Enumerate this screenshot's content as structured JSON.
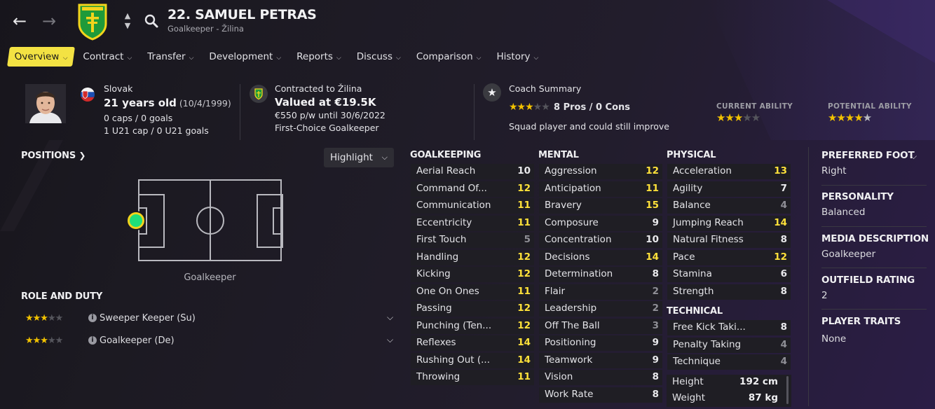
{
  "nav": {
    "back_icon": "arrow-left-icon",
    "forward_icon": "arrow-right-icon"
  },
  "header": {
    "title": "22. SAMUEL PETRAS",
    "subtitle": "Goalkeeper - Žilina"
  },
  "tabs": [
    {
      "label": "Overview",
      "active": true
    },
    {
      "label": "Contract"
    },
    {
      "label": "Transfer"
    },
    {
      "label": "Development"
    },
    {
      "label": "Reports"
    },
    {
      "label": "Discuss"
    },
    {
      "label": "Comparison"
    },
    {
      "label": "History"
    }
  ],
  "bio": {
    "nationality": "Slovak",
    "age": "21 years old",
    "dob": "(10/4/1999)",
    "caps": "0 caps / 0 goals",
    "u21": "1 U21 cap / 0 U21 goals"
  },
  "contract": {
    "contracted_to": "Contracted to Žilina",
    "value": "Valued at €19.5K",
    "wage": "€550 p/w until 30/6/2022",
    "status": "First-Choice Goalkeeper"
  },
  "coach": {
    "label": "Coach Summary",
    "stars": 3,
    "pros_cons": "8 Pros / 0 Cons",
    "summary": "Squad player and could still improve"
  },
  "ability": {
    "current_label": "CURRENT ABILITY",
    "current_stars": 3,
    "potential_label": "POTENTIAL ABILITY",
    "potential_stars": 4.5
  },
  "positions": {
    "label": "POSITIONS",
    "highlight": "Highlight",
    "position_name": "Goalkeeper"
  },
  "roles": {
    "label": "ROLE AND DUTY",
    "items": [
      {
        "stars": 3,
        "name": "Sweeper Keeper (Su)"
      },
      {
        "stars": 3,
        "name": "Goalkeeper (De)"
      }
    ]
  },
  "goalkeeping": {
    "label": "GOALKEEPING",
    "rows": [
      {
        "name": "Aerial Reach",
        "value": "10"
      },
      {
        "name": "Command Of...",
        "value": "12"
      },
      {
        "name": "Communication",
        "value": "11"
      },
      {
        "name": "Eccentricity",
        "value": "11"
      },
      {
        "name": "First Touch",
        "value": "5"
      },
      {
        "name": "Handling",
        "value": "12"
      },
      {
        "name": "Kicking",
        "value": "12"
      },
      {
        "name": "One On Ones",
        "value": "11"
      },
      {
        "name": "Passing",
        "value": "12"
      },
      {
        "name": "Punching (Ten...",
        "value": "12"
      },
      {
        "name": "Reflexes",
        "value": "14"
      },
      {
        "name": "Rushing Out (...",
        "value": "14"
      },
      {
        "name": "Throwing",
        "value": "11"
      }
    ]
  },
  "mental": {
    "label": "MENTAL",
    "rows": [
      {
        "name": "Aggression",
        "value": "12"
      },
      {
        "name": "Anticipation",
        "value": "11"
      },
      {
        "name": "Bravery",
        "value": "15"
      },
      {
        "name": "Composure",
        "value": "9"
      },
      {
        "name": "Concentration",
        "value": "10"
      },
      {
        "name": "Decisions",
        "value": "14"
      },
      {
        "name": "Determination",
        "value": "8"
      },
      {
        "name": "Flair",
        "value": "2"
      },
      {
        "name": "Leadership",
        "value": "2"
      },
      {
        "name": "Off The Ball",
        "value": "3"
      },
      {
        "name": "Positioning",
        "value": "9"
      },
      {
        "name": "Teamwork",
        "value": "9"
      },
      {
        "name": "Vision",
        "value": "8"
      },
      {
        "name": "Work Rate",
        "value": "8"
      }
    ]
  },
  "physical": {
    "label": "PHYSICAL",
    "rows": [
      {
        "name": "Acceleration",
        "value": "13"
      },
      {
        "name": "Agility",
        "value": "7"
      },
      {
        "name": "Balance",
        "value": "4"
      },
      {
        "name": "Jumping Reach",
        "value": "14"
      },
      {
        "name": "Natural Fitness",
        "value": "8"
      },
      {
        "name": "Pace",
        "value": "12"
      },
      {
        "name": "Stamina",
        "value": "6"
      },
      {
        "name": "Strength",
        "value": "8"
      }
    ]
  },
  "technical": {
    "label": "TECHNICAL",
    "rows": [
      {
        "name": "Free Kick Taki...",
        "value": "8"
      },
      {
        "name": "Penalty Taking",
        "value": "4"
      },
      {
        "name": "Technique",
        "value": "4"
      }
    ]
  },
  "measures": {
    "height_label": "Height",
    "height": "192 cm",
    "weight_label": "Weight",
    "weight": "87 kg"
  },
  "side": {
    "preferred_foot_label": "PREFERRED FOOT",
    "preferred_foot": "Right",
    "personality_label": "PERSONALITY",
    "personality": "Balanced",
    "media_label": "MEDIA DESCRIPTION",
    "media": "Goalkeeper",
    "outfield_label": "OUTFIELD RATING",
    "outfield": "2",
    "traits_label": "PLAYER TRAITS",
    "traits": "None"
  },
  "colors": {
    "accent": "#f3e243",
    "highlight_value": "#ffe23a",
    "club_green": "#1f9a3a",
    "position_dot": "#1fe07a"
  }
}
